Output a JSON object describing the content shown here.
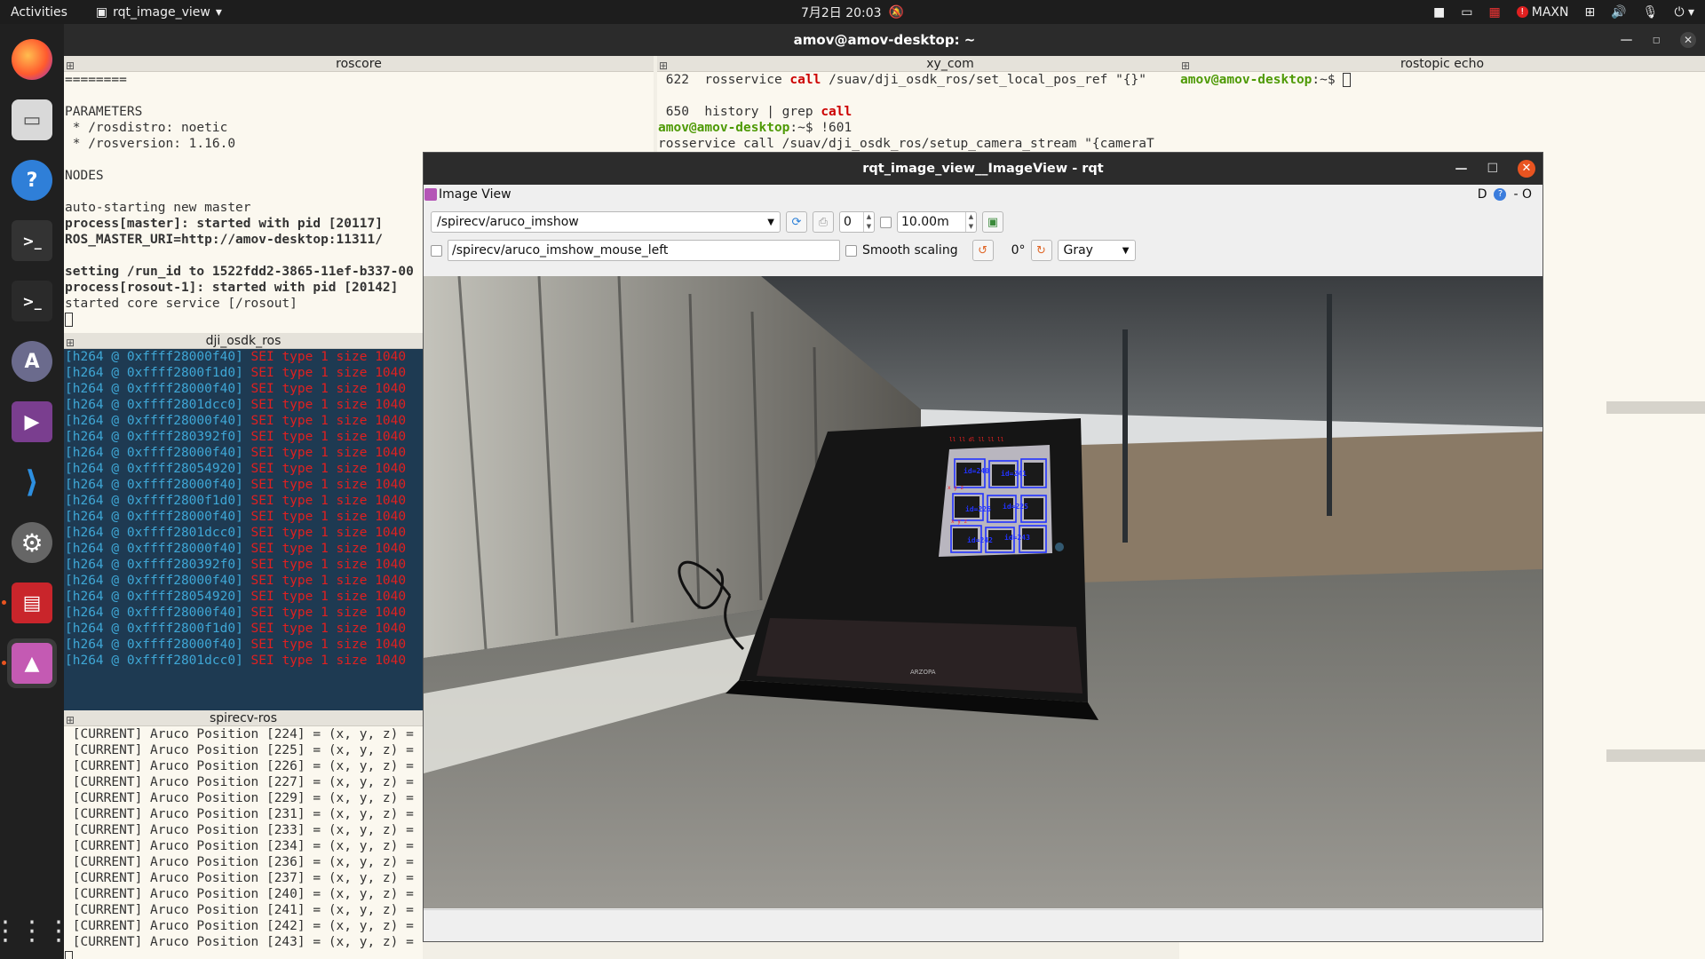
{
  "topbar": {
    "activities": "Activities",
    "app_name": "rqt_image_view",
    "clock": "7月2日  20:03",
    "power_mode": "MAXN"
  },
  "dock": {
    "items": [
      "firefox-icon",
      "files-icon",
      "help-icon",
      "terminal-icon",
      "terminal2-icon",
      "software-icon",
      "video-icon",
      "vscode-icon",
      "settings-icon",
      "presentation-icon",
      "image-viewer-icon"
    ]
  },
  "terminal": {
    "title": "amov@amov-desktop: ~",
    "panes": {
      "roscore": {
        "title": "roscore",
        "lines": [
          "========",
          "",
          "PARAMETERS",
          " * /rosdistro: noetic",
          " * /rosversion: 1.16.0",
          "",
          "NODES",
          "",
          "auto-starting new master"
        ],
        "bold_lines": [
          "process[master]: started with pid [20117]",
          "ROS_MASTER_URI=http://amov-desktop:11311/",
          "",
          "setting /run_id to 1522fdd2-3865-11ef-b337-00",
          "process[rosout-1]: started with pid [20142]"
        ],
        "last_line": "started core service [/rosout]"
      },
      "xy_com": {
        "title": "xy_com",
        "line1_num": " 622",
        "line1_a": "  rosservice ",
        "line1_call": "call",
        "line1_b": " /suav/dji_osdk_ros/set_local_pos_ref \"{}\"",
        "line2_num": " 650",
        "line2_a": "  history | grep ",
        "line2_call": "call",
        "prompt": "amov@amov-desktop",
        "prompt_rest": ":~$ !601",
        "line4": "rosservice call /suav/dji_osdk_ros/setup_camera_stream \"{cameraT"
      },
      "rostopic": {
        "title": "rostopic echo",
        "prompt": "amov@amov-desktop",
        "prompt_rest": ":~$ "
      },
      "dji": {
        "title": "dji_osdk_ros",
        "addresses": [
          "0xffff28000f40",
          "0xffff2800f1d0",
          "0xffff28000f40",
          "0xffff2801dcc0",
          "0xffff28000f40",
          "0xffff280392f0",
          "0xffff28000f40",
          "0xffff28054920",
          "0xffff28000f40",
          "0xffff2800f1d0",
          "0xffff28000f40",
          "0xffff2801dcc0",
          "0xffff28000f40",
          "0xffff280392f0",
          "0xffff28000f40",
          "0xffff28054920",
          "0xffff28000f40",
          "0xffff2800f1d0",
          "0xffff28000f40",
          "0xffff2801dcc0"
        ],
        "prefix": "[h264 @ ",
        "suffix": "]",
        "message": " SEI type 1 size 1040"
      },
      "spirecv": {
        "title": "spirecv-ros",
        "ids": [
          "224",
          "225",
          "226",
          "227",
          "229",
          "231",
          "233",
          "234",
          "236",
          "237",
          "240",
          "241",
          "242",
          "243"
        ],
        "prefix": " [CURRENT] Aruco Position [",
        "suffix": "] = (x, y, z) ="
      }
    }
  },
  "rqt": {
    "title": "rqt_image_view__ImageView - rqt",
    "plugin_title": "Image View",
    "dock_right": "D",
    "dock_right2": "- O",
    "topic": "/spirecv/aruco_imshow",
    "spin_value": "0",
    "spin_max": "10.00m",
    "mouse_topic": "/spirecv/aruco_imshow_mouse_left",
    "smooth_scaling": "Smooth scaling",
    "rotation": "0°",
    "color_scheme": "Gray",
    "monitor_brand": "ARZOPA"
  }
}
